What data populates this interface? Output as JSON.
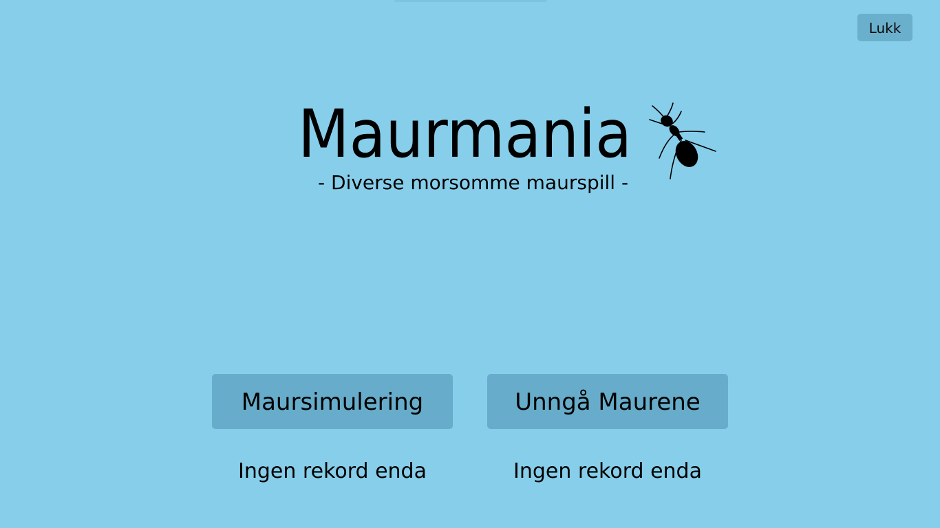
{
  "header": {
    "close_label": "Lukk"
  },
  "hero": {
    "title": "Maurmania",
    "subtitle": "- Diverse morsomme maurspill -",
    "logo_icon": "ant-icon"
  },
  "games": [
    {
      "label": "Maursimulering",
      "record": "Ingen rekord enda"
    },
    {
      "label": "Unngå Maurene",
      "record": "Ingen rekord enda"
    }
  ],
  "colors": {
    "background": "#87ceea",
    "button": "#67adcb",
    "text": "#000000"
  }
}
